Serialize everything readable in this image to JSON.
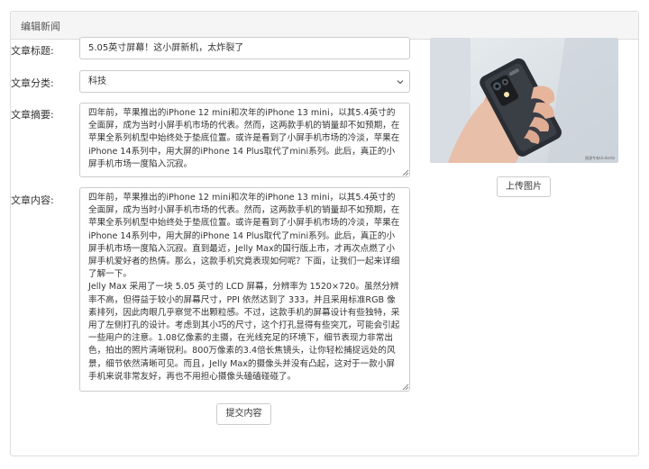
{
  "panel": {
    "heading": "编辑新闻"
  },
  "form": {
    "title_label": "文章标题:",
    "title_value": "5.05英寸屏幕！这小屏新机，太炸裂了",
    "category_label": "文章分类:",
    "category_value": "科技",
    "summary_label": "文章摘要:",
    "summary_value": "四年前，苹果推出的iPhone 12 mini和次年的iPhone 13 mini，以其5.4英寸的全面屏，成为当时小屏手机市场的代表。然而，这两款手机的销量却不如预期，在苹果全系列机型中始终处于垫底位置。或许是看到了小屏手机市场的冷淡，苹果在iPhone 14系列中，用大屏的iPhone 14 Plus取代了mini系列。此后，真正的小屏手机市场一度陷入沉寂。",
    "content_label": "文章内容:",
    "content_value": "四年前，苹果推出的iPhone 12 mini和次年的iPhone 13 mini，以其5.4英寸的全面屏，成为当时小屏手机市场的代表。然而，这两款手机的销量却不如预期，在苹果全系列机型中始终处于垫底位置。或许是看到了小屏手机市场的冷淡，苹果在iPhone 14系列中，用大屏的iPhone 14 Plus取代了mini系列。此后，真正的小屏手机市场一度陷入沉寂。直到最近，Jelly Max的国行版上市，才再次点燃了小屏手机爱好者的热情。那么，这款手机究竟表现如何呢？下面，让我们一起来详细了解一下。\nJelly Max 采用了一块 5.05 英寸的 LCD 屏幕，分辨率为 1520×720。虽然分辨率不高，但得益于较小的屏幕尺寸，PPI 依然达到了 333，并且采用标准RGB 像素排列，因此肉眼几乎察觉不出颗粒感。不过，这款手机的屏幕设计有些独特，采用了左侧打孔的设计。考虑到其小巧的尺寸，这个打孔显得有些突兀，可能会引起一些用户的注意。1.08亿像素的主摄，在光线充足的环境下，细节表现力非常出色，拍出的照片清晰锐利。800万像素的3.4倍长焦镜头，让你轻松捕捉远处的风景，细节依然清晰可见。而且，Jelly Max的摄像头并没有凸起，这对于一款小屏手机来说非常友好，再也不用担心摄像头磕磕碰碰了。",
    "photo_caption": "图源专有Unihertz",
    "upload_label": "上传图片",
    "submit_label": "提交内容"
  },
  "icons": {
    "select": "chevron-down-icon",
    "resize": "resize-grip-icon"
  }
}
